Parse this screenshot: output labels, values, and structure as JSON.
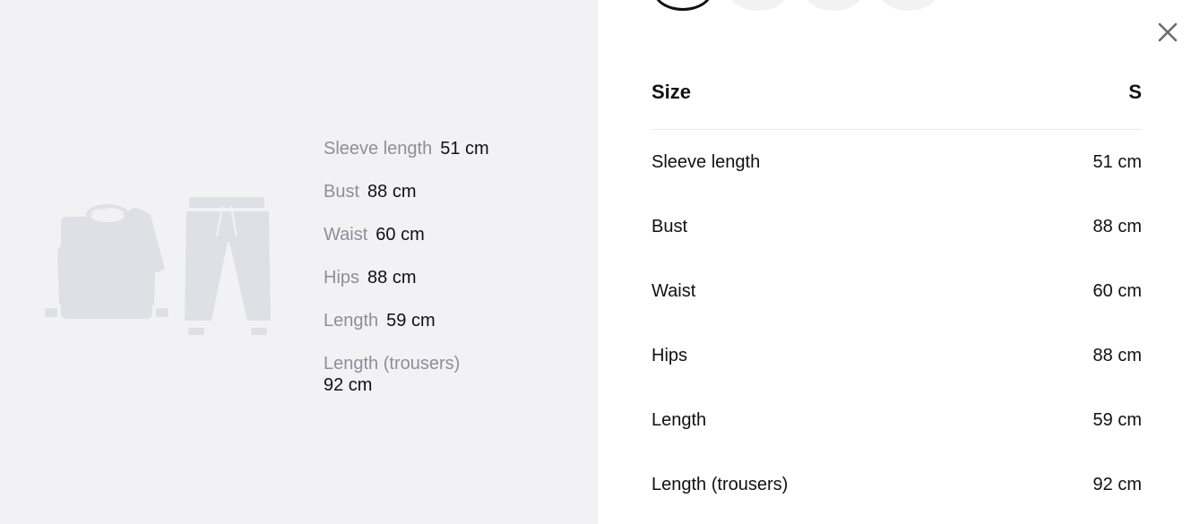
{
  "size_swatches": [
    {
      "state": "selected"
    },
    {
      "state": "default"
    },
    {
      "state": "default"
    },
    {
      "state": "default"
    }
  ],
  "close": {
    "icon": "close-icon"
  },
  "illustration": {
    "top_icon": "sweater-icon",
    "bottom_icon": "trousers-icon",
    "color": "#dfdfe6"
  },
  "summary": [
    {
      "label": "Sleeve length",
      "value": "51 cm"
    },
    {
      "label": "Bust",
      "value": "88 cm"
    },
    {
      "label": "Waist",
      "value": "60 cm"
    },
    {
      "label": "Hips",
      "value": "88 cm"
    },
    {
      "label": "Length",
      "value": "59 cm"
    },
    {
      "label": "Length (trousers)",
      "value": "92 cm"
    }
  ],
  "table": {
    "header": {
      "left": "Size",
      "right": "S"
    },
    "rows": [
      {
        "name": "Sleeve length",
        "value": "51 cm"
      },
      {
        "name": "Bust",
        "value": "88 cm"
      },
      {
        "name": "Waist",
        "value": "60 cm"
      },
      {
        "name": "Hips",
        "value": "88 cm"
      },
      {
        "name": "Length",
        "value": "59 cm"
      },
      {
        "name": "Length (trousers)",
        "value": "92 cm"
      }
    ]
  },
  "colors": {
    "panel_background": "#f2f2f5",
    "muted_label": "#8e8e99",
    "text": "#111111",
    "divider": "#ebebef"
  }
}
